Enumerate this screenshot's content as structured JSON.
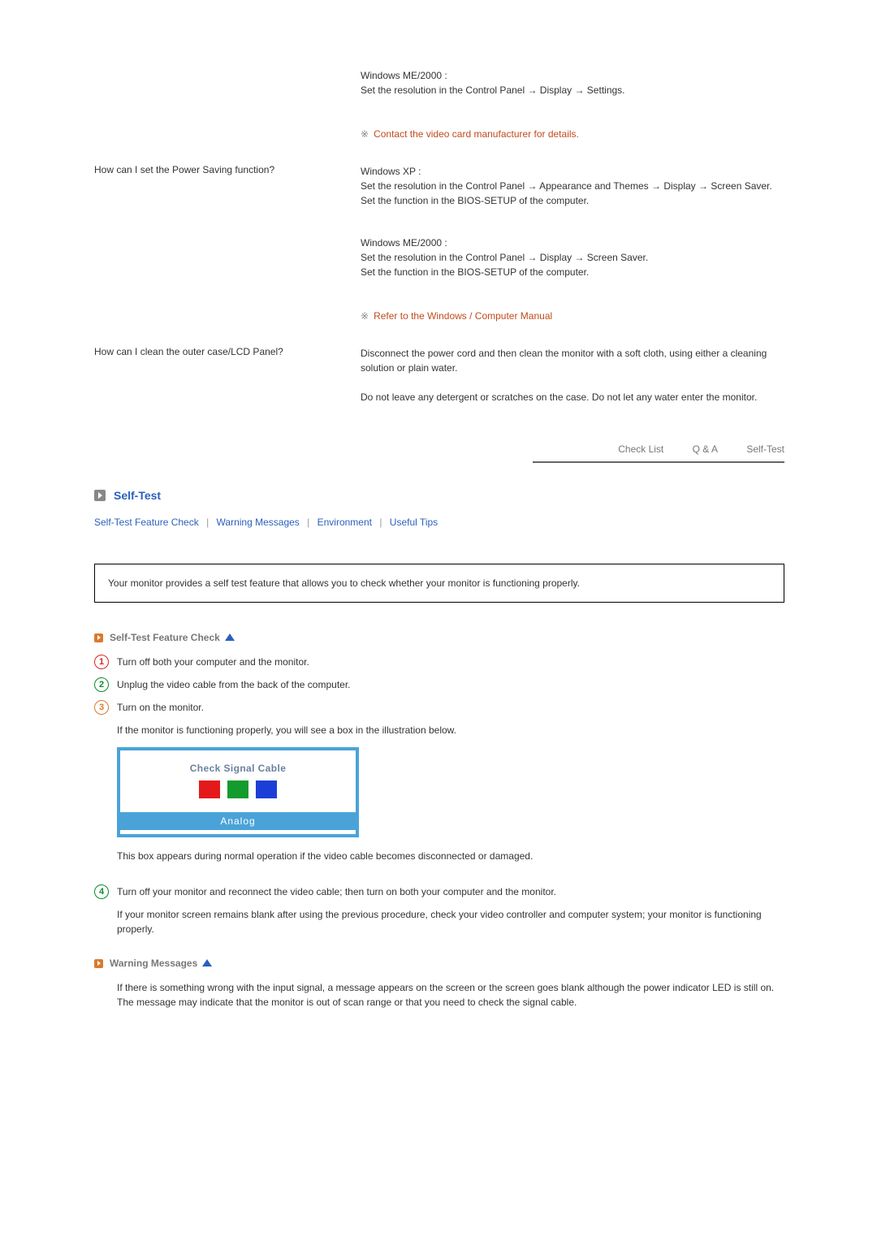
{
  "qa": {
    "r1": {
      "ans_me_head": "Windows ME/2000 :",
      "ans_me_body": "Set the resolution in the Control Panel → Display → Settings.",
      "note": "Contact the video card manufacturer for details."
    },
    "r2": {
      "q": "How can I set the Power Saving function?",
      "xp_head": "Windows XP :",
      "xp_body": "Set the resolution in the Control Panel → Appearance and Themes → Display → Screen Saver.\nSet the function in the BIOS-SETUP of the computer.",
      "me_head": "Windows ME/2000 :",
      "me_body": "Set the resolution in the Control Panel → Display → Screen Saver.\nSet the function in the BIOS-SETUP of the computer.",
      "note": "Refer to the Windows / Computer Manual"
    },
    "r3": {
      "q": "How can I clean the outer case/LCD Panel?",
      "a1": "Disconnect the power cord and then clean the monitor with a soft cloth, using either a cleaning solution or plain water.",
      "a2": "Do not leave any detergent or scratches on the case. Do not let any water enter the monitor."
    }
  },
  "subnav": {
    "checklist": "Check List",
    "qa": "Q & A",
    "selftest": "Self-Test"
  },
  "section": {
    "title": "Self-Test"
  },
  "anchors": {
    "a1": "Self-Test Feature Check",
    "a2": "Warning Messages",
    "a3": "Environment",
    "a4": "Useful Tips"
  },
  "callout": "Your monitor provides a self test feature that allows you to check whether your monitor is functioning properly.",
  "selftest": {
    "subtitle": "Self-Test Feature Check",
    "s1": "Turn off both your computer and the monitor.",
    "s2": "Unplug the video cable from the back of the computer.",
    "s3": "Turn on the monitor.",
    "s3b": "If the monitor is functioning properly, you will see a box in the illustration below.",
    "illust_title": "Check Signal Cable",
    "illust_bar": "Analog",
    "after_illust": "This box appears during normal operation if the video cable becomes disconnected or damaged.",
    "s4": "Turn off your monitor and reconnect the video cable; then turn on both your computer and the monitor.",
    "s4b": "If your monitor screen remains blank after using the previous procedure, check your video controller and computer system; your monitor is functioning properly."
  },
  "warning": {
    "subtitle": "Warning Messages",
    "body": "If there is something wrong with the input signal, a message appears on the screen or the screen goes blank although the power indicator LED is still on. The message may indicate that the monitor is out of scan range or that you need to check the signal cable."
  }
}
